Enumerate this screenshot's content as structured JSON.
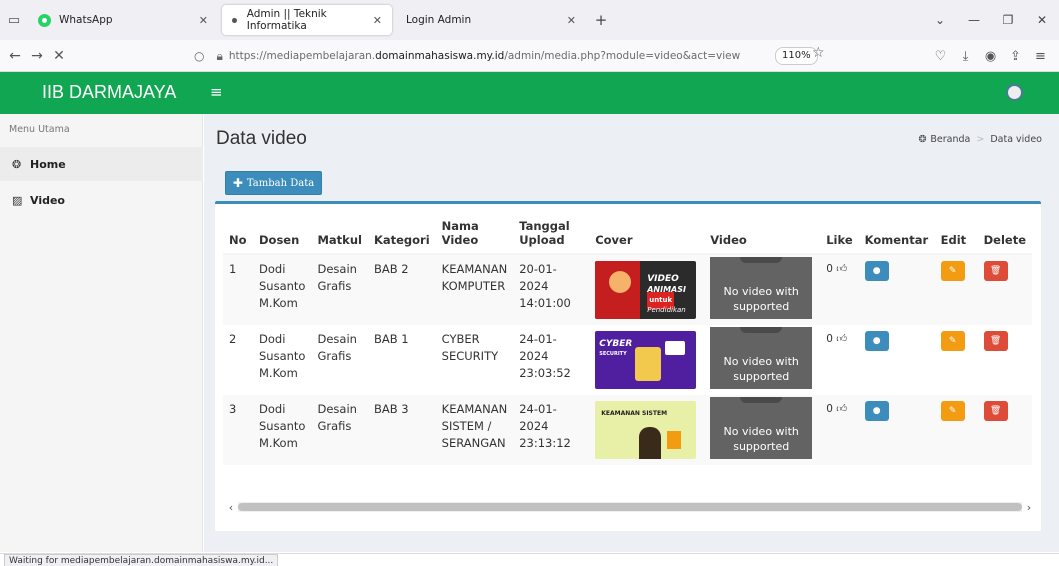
{
  "browser": {
    "tabs": [
      {
        "title": "WhatsApp"
      },
      {
        "title": "Admin || Teknik Informatika"
      },
      {
        "title": "Login Admin"
      }
    ],
    "url_prefix": "https://mediapembelajaran.",
    "url_domain": "domainmahasiswa.my.id",
    "url_suffix": "/admin/media.php?module=video&act=view",
    "zoom": "110%",
    "status": "Waiting for mediapembelajaran.domainmahasiswa.my.id..."
  },
  "header": {
    "brand": "IIB DARMAJAYA"
  },
  "sidebar": {
    "title": "Menu Utama",
    "items": [
      {
        "label": "Home"
      },
      {
        "label": "Video"
      }
    ]
  },
  "main": {
    "title": "Data video",
    "breadcrumb": {
      "home": "Beranda",
      "current": "Data video"
    },
    "add_button": "Tambah Data",
    "columns": [
      "No",
      "Dosen",
      "Matkul",
      "Kategori",
      "Nama Video",
      "Tanggal Upload",
      "Cover",
      "Video",
      "Like",
      "Komentar",
      "Edit",
      "Delete"
    ],
    "video_placeholder": "No video with supported",
    "rows": [
      {
        "no": "1",
        "dosen": "Dodi Susanto M.Kom",
        "matkul": "Desain Grafis",
        "kategori": "BAB 2",
        "nama": "KEAMANAN KOMPUTER",
        "tanggal": "20-01-2024 14:01:00",
        "like": "0",
        "cover_text": [
          "VIDEO",
          "ANIMASI",
          "untuk",
          "Pendidikan"
        ]
      },
      {
        "no": "2",
        "dosen": "Dodi Susanto M.Kom",
        "matkul": "Desain Grafis",
        "kategori": "BAB 1",
        "nama": "CYBER SECURITY",
        "tanggal": "24-01-2024 23:03:52",
        "like": "0",
        "cover_text": [
          "CYBER",
          "SECURITY"
        ]
      },
      {
        "no": "3",
        "dosen": "Dodi Susanto M.Kom",
        "matkul": "Desain Grafis",
        "kategori": "BAB 3",
        "nama": "KEAMANAN SISTEM / SERANGAN",
        "tanggal": "24-01-2024 23:13:12",
        "like": "0",
        "cover_text": [
          "KEAMANAN SISTEM"
        ]
      }
    ]
  },
  "colors": {
    "header_green": "#11a652",
    "primary_blue": "#3c8dbc",
    "edit_orange": "#f39c12",
    "delete_red": "#dd4b39"
  },
  "icons": {
    "home": "dashboard-icon",
    "video": "image-icon",
    "like": "thumbs-up-icon",
    "comment": "comment-icon",
    "edit": "edit-icon",
    "delete": "trash-icon"
  }
}
